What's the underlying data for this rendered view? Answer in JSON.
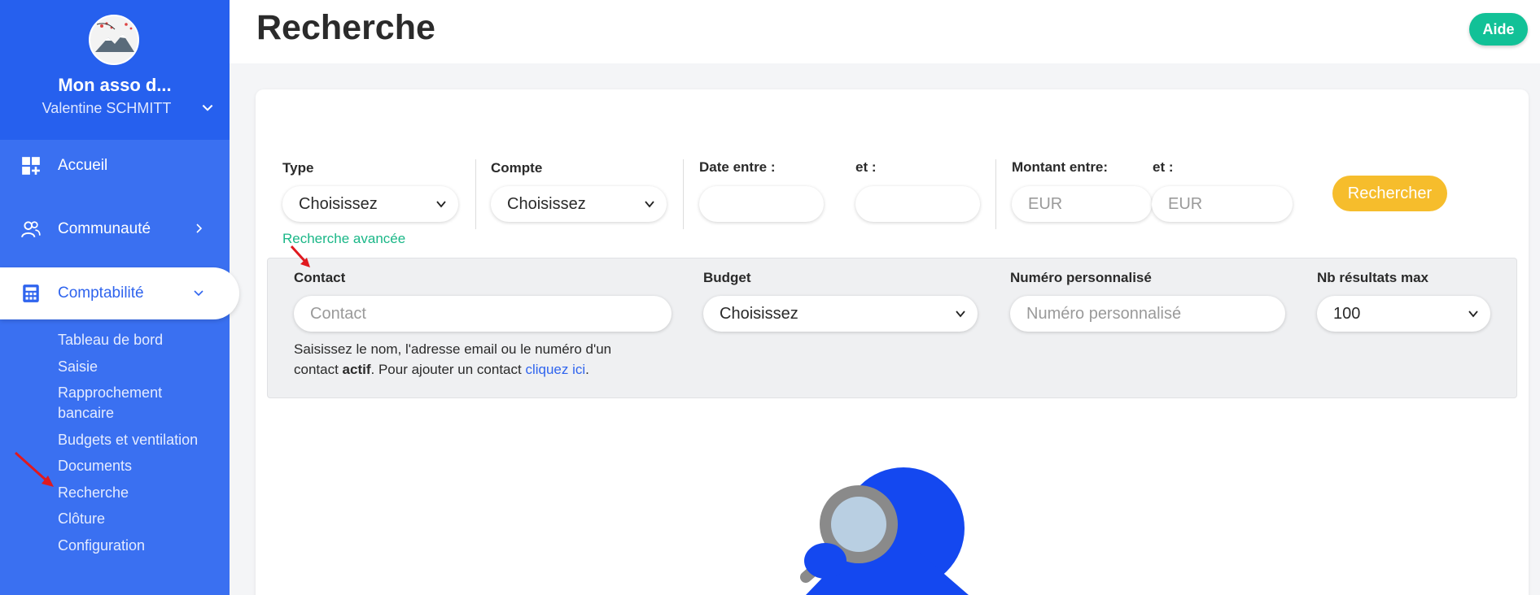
{
  "sidebar": {
    "org_name": "Mon asso d...",
    "user_name": "Valentine SCHMITT",
    "nav": [
      {
        "label": "Accueil",
        "icon": "dashboard-icon"
      },
      {
        "label": "Communauté",
        "icon": "users-icon"
      },
      {
        "label": "Comptabilité",
        "icon": "calculator-icon"
      }
    ],
    "sub_items": [
      "Tableau de bord",
      "Saisie",
      "Rapprochement bancaire",
      "Budgets et ventilation",
      "Documents",
      "Recherche",
      "Clôture",
      "Configuration"
    ]
  },
  "header": {
    "title": "Recherche",
    "help_label": "Aide"
  },
  "filters": {
    "type_label": "Type",
    "type_value": "Choisissez",
    "account_label": "Compte",
    "account_value": "Choisissez",
    "date_label": "Date entre :",
    "date_and_label": "et :",
    "amount_label": "Montant entre:",
    "amount_and_label": "et :",
    "amount_min_placeholder": "EUR",
    "amount_max_placeholder": "EUR",
    "search_label": "Rechercher",
    "advanced_link": "Recherche avancée"
  },
  "advanced": {
    "contact_label": "Contact",
    "contact_placeholder": "Contact",
    "budget_label": "Budget",
    "budget_value": "Choisissez",
    "custom_number_label": "Numéro personnalisé",
    "custom_number_placeholder": "Numéro personnalisé",
    "max_results_label": "Nb résultats max",
    "max_results_value": "100",
    "help_part1": "Saisissez le nom, l'adresse email ou le numéro d'un contact ",
    "help_bold": "actif",
    "help_part2": ". Pour ajouter un contact ",
    "help_link": "cliquez ici",
    "help_end": "."
  },
  "colors": {
    "sidebar": "#3a70f1",
    "sidebar_top": "#2660ee",
    "accent_green": "#12c197",
    "search_button": "#f6bd2c",
    "link_blue": "#2f64ee"
  }
}
